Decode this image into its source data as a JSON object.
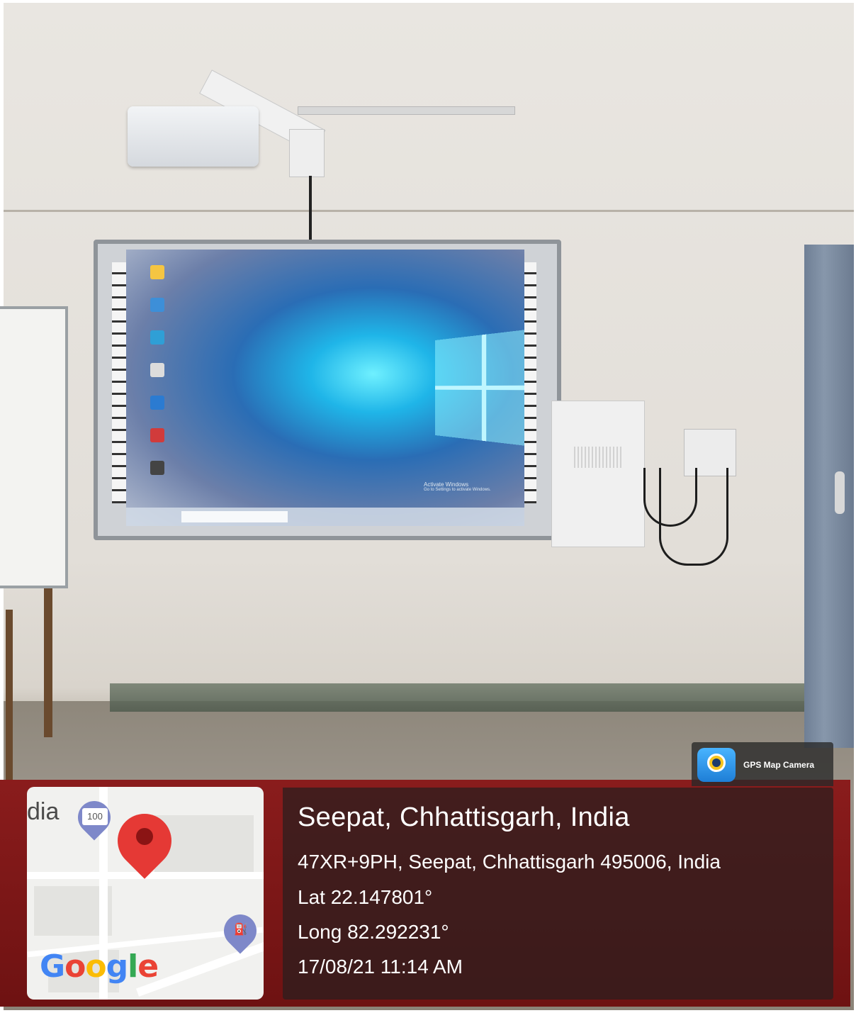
{
  "overlay": {
    "app_badge": "GPS Map Camera",
    "place_title": "Seepat, Chhattisgarh, India",
    "address": "47XR+9PH, Seepat, Chhattisgarh 495006, India",
    "latitude": "Lat 22.147801°",
    "longitude": "Long 82.292231°",
    "datetime": "17/08/21 11:14 AM"
  },
  "map": {
    "partial_label": "dia",
    "speed_badge": "100",
    "provider_logo": [
      "G",
      "o",
      "o",
      "g",
      "l",
      "e"
    ],
    "logo_colors": [
      "#4285F4",
      "#EA4335",
      "#FBBC05",
      "#4285F4",
      "#34A853",
      "#EA4335"
    ],
    "icons": [
      "location-pin-icon",
      "fuel-station-pin-icon",
      "speed-limit-pin-icon"
    ]
  },
  "screen": {
    "watermark_line1": "Activate Windows",
    "watermark_line2": "Go to Settings to activate Windows."
  },
  "colors": {
    "overlay_panel": "#281e1e",
    "pin_red": "#e53935",
    "pin_purple": "#7e88c9"
  }
}
